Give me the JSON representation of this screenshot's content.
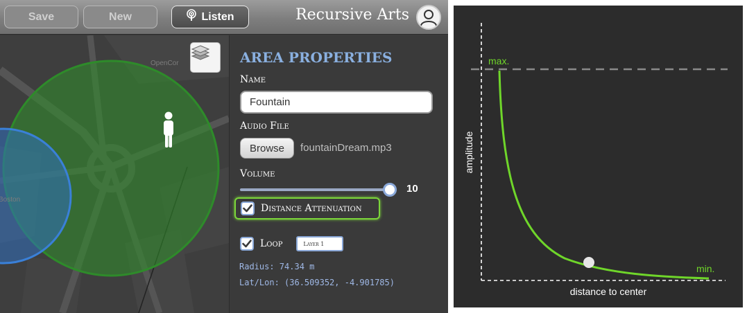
{
  "toolbar": {
    "save_label": "Save",
    "new_label": "New",
    "listen_label": "Listen"
  },
  "brand": {
    "title": "Recursive Arts"
  },
  "map": {
    "labels": [
      "OpenCor",
      "Boston"
    ]
  },
  "properties": {
    "heading": "AREA PROPERTIES",
    "name_label": "Name",
    "name_value": "Fountain",
    "audio_label": "Audio File",
    "browse_label": "Browse",
    "file_name": "fountainDream.mp3",
    "volume_label": "Volume",
    "volume_value": "10",
    "volume_fraction": 1.0,
    "distance_attenuation_label": "Distance Attenuation",
    "distance_attenuation_checked": true,
    "loop_label": "Loop",
    "loop_checked": true,
    "layer_value": "Layer 1",
    "radius_text": "Radius: 74.34 m",
    "latlon_text": "Lat/Lon: (36.509352, -4.901785)"
  },
  "diagram": {
    "y_axis_label": "amplitude",
    "x_axis_label": "distance to center",
    "max_label": "max.",
    "min_label": "min."
  },
  "colors": {
    "accent_green": "#7cd63a",
    "heading_blue": "#8ab0e0",
    "info_blue": "#9fb8e6"
  }
}
